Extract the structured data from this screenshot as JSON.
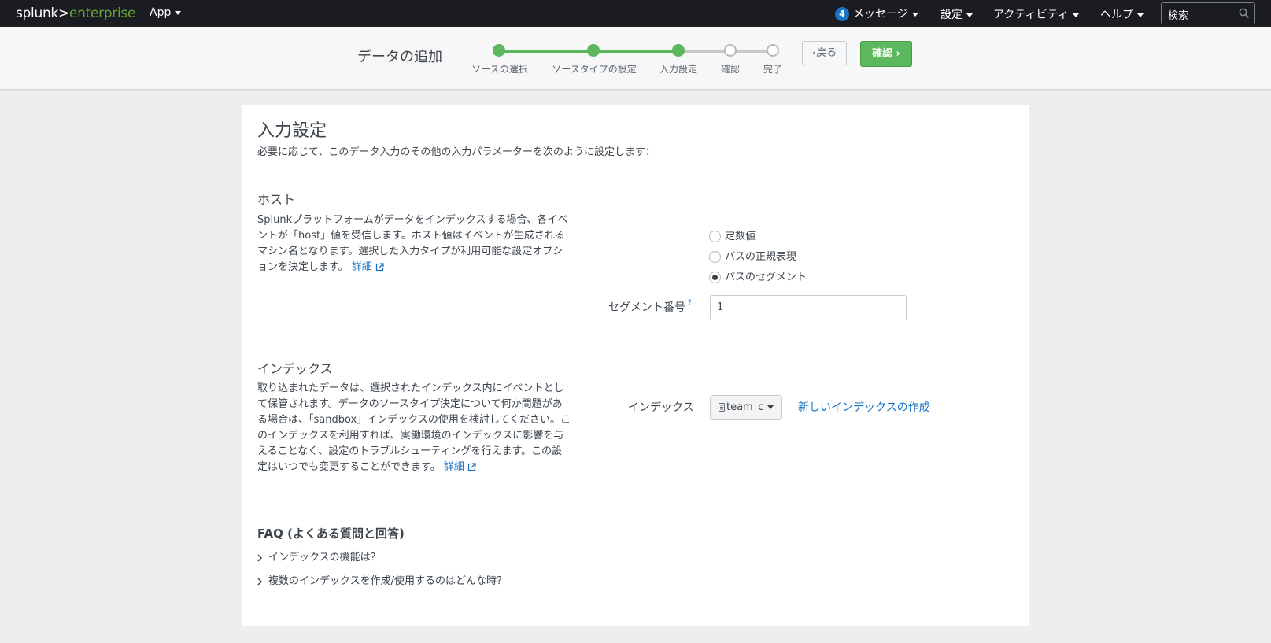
{
  "topbar": {
    "logo_a": "splunk>",
    "logo_b": "enterprise",
    "app_label": "App",
    "messages_badge": "4",
    "messages_label": "メッセージ",
    "settings_label": "設定",
    "activity_label": "アクティビティ",
    "help_label": "ヘルプ",
    "search_placeholder": "検索"
  },
  "wizard": {
    "title": "データの追加",
    "steps": [
      {
        "label": "ソースの選択",
        "state": "done"
      },
      {
        "label": "ソースタイプの設定",
        "state": "done"
      },
      {
        "label": "入力設定",
        "state": "current"
      },
      {
        "label": "確認",
        "state": "todo"
      },
      {
        "label": "完了",
        "state": "todo"
      }
    ],
    "back_label": "戻る",
    "next_label": "確認"
  },
  "main": {
    "title": "入力設定",
    "intro": "必要に応じて、このデータ入力のその他の入力パラメーターを次のように設定します：",
    "host": {
      "title": "ホスト",
      "desc": "Splunkプラットフォームがデータをインデックスする場合、各イベントが「host」値を受信します。ホスト値はイベントが生成されるマシン名となります。選択した入力タイプが利用可能な設定オプションを決定します。",
      "more_link": "詳細",
      "options": [
        {
          "label": "定数値",
          "selected": false
        },
        {
          "label": "パスの正規表現",
          "selected": false
        },
        {
          "label": "パスのセグメント",
          "selected": true
        }
      ],
      "segment_label": "セグメント番号",
      "segment_help": "?",
      "segment_value": "1"
    },
    "index": {
      "title": "インデックス",
      "desc": "取り込まれたデータは、選択されたインデックス内にイベントとして保管されます。データのソースタイプ決定について何か問題がある場合は、「sandbox」インデックスの使用を検討してください。このインデックスを利用すれば、実働環境のインデックスに影響を与えることなく、設定のトラブルシューティングを行えます。この設定はいつでも変更することができます。",
      "more_link": "詳細",
      "field_label": "インデックス",
      "selected_value": "team_c",
      "new_index_link": "新しいインデックスの作成"
    },
    "faq": {
      "title": "FAQ (よくある質問と回答)",
      "items": [
        "インデックスの機能は？",
        "複数のインデックスを作成/使用するのはどんな時？"
      ]
    }
  },
  "colors": {
    "topbar_bg": "#1a1c21",
    "brand_green": "#65a637",
    "step_done": "#5cb85c",
    "link_blue": "#1a73c2"
  }
}
